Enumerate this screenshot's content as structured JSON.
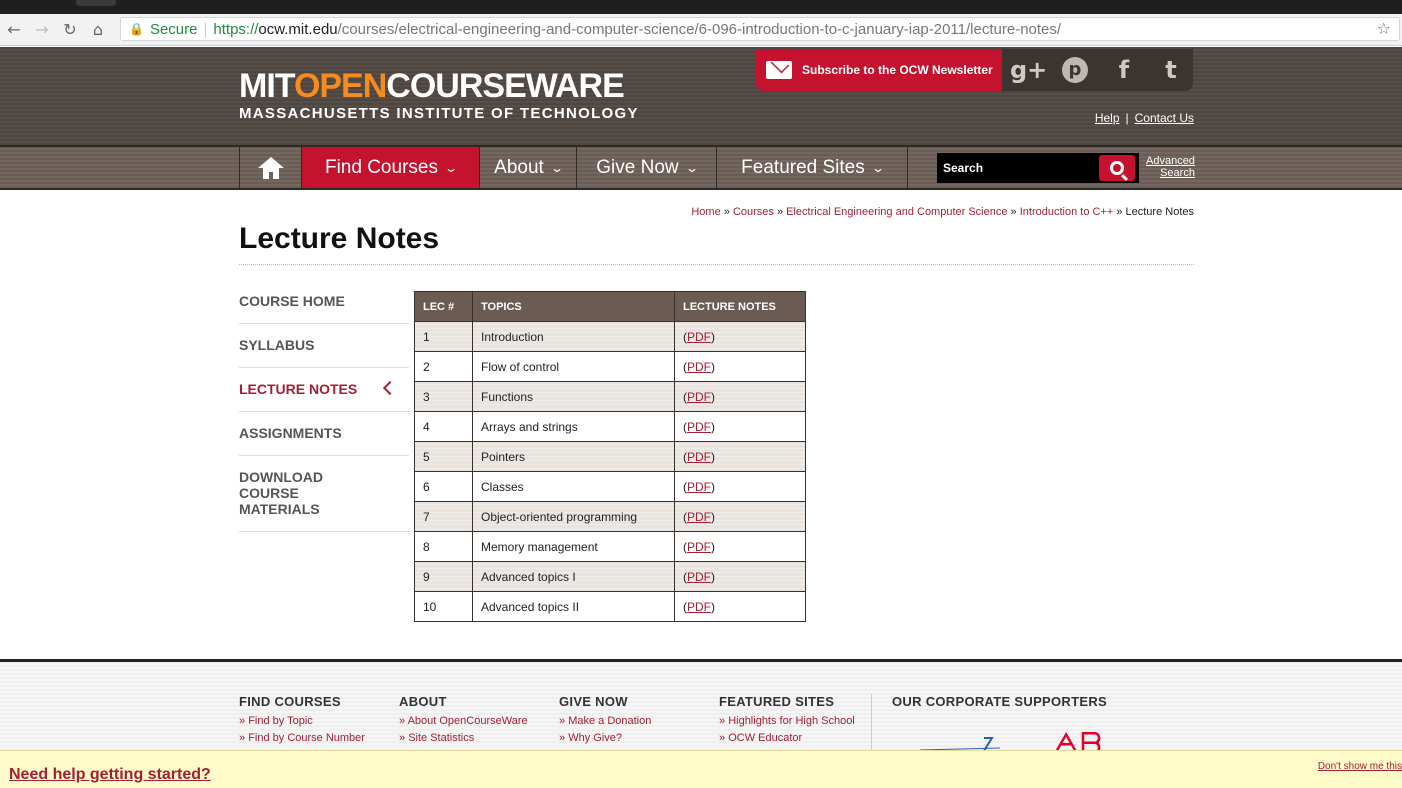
{
  "browser": {
    "secure_label": "Secure",
    "url_scheme": "https://",
    "url_host": "ocw.mit.edu",
    "url_path": "/courses/electrical-engineering-and-computer-science/6-096-introduction-to-c-january-iap-2011/lecture-notes/"
  },
  "header": {
    "logo_part1": "MIT",
    "logo_part2": "OPEN",
    "logo_part3": "COURSEWARE",
    "logo_sub": "MASSACHUSETTS INSTITUTE OF TECHNOLOGY",
    "subscribe_label": "Subscribe to the OCW Newsletter",
    "help_label": "Help",
    "contact_label": "Contact Us"
  },
  "nav": {
    "find_courses": "Find Courses",
    "about": "About",
    "give_now": "Give Now",
    "featured_sites": "Featured Sites",
    "search_placeholder": "Search",
    "advanced": "Advanced",
    "search": "Search"
  },
  "breadcrumb": {
    "items": [
      "Home",
      "Courses",
      "Electrical Engineering and Computer Science",
      "Introduction to C++"
    ],
    "current": "Lecture Notes"
  },
  "page_title": "Lecture Notes",
  "sidenav": {
    "items": [
      "COURSE HOME",
      "SYLLABUS",
      "LECTURE NOTES",
      "ASSIGNMENTS",
      "DOWNLOAD COURSE MATERIALS"
    ],
    "active": "LECTURE NOTES"
  },
  "table": {
    "headers": [
      "LEC #",
      "TOPICS",
      "LECTURE NOTES"
    ],
    "rows": [
      {
        "lec": "1",
        "topic": "Introduction",
        "notes": "PDF"
      },
      {
        "lec": "2",
        "topic": "Flow of control",
        "notes": "PDF"
      },
      {
        "lec": "3",
        "topic": "Functions",
        "notes": "PDF"
      },
      {
        "lec": "4",
        "topic": "Arrays and strings",
        "notes": "PDF"
      },
      {
        "lec": "5",
        "topic": "Pointers",
        "notes": "PDF"
      },
      {
        "lec": "6",
        "topic": "Classes",
        "notes": "PDF"
      },
      {
        "lec": "7",
        "topic": "Object-oriented programming",
        "notes": "PDF"
      },
      {
        "lec": "8",
        "topic": "Memory management",
        "notes": "PDF"
      },
      {
        "lec": "9",
        "topic": "Advanced topics I",
        "notes": "PDF"
      },
      {
        "lec": "10",
        "topic": "Advanced topics II",
        "notes": "PDF"
      }
    ]
  },
  "footer": {
    "find_courses": {
      "title": "FIND COURSES",
      "links": [
        "Find by Topic",
        "Find by Course Number"
      ]
    },
    "about": {
      "title": "ABOUT",
      "links": [
        "About OpenCourseWare",
        "Site Statistics"
      ]
    },
    "give_now": {
      "title": "GIVE NOW",
      "links": [
        "Make a Donation",
        "Why Give?"
      ]
    },
    "featured_sites": {
      "title": "FEATURED SITES",
      "links": [
        "Highlights for High School",
        "OCW Educator"
      ]
    },
    "supporters_title": "OUR CORPORATE SUPPORTERS"
  },
  "help_bar": {
    "link": "Need help getting started?",
    "dismiss": "Don't show me this"
  },
  "colors": {
    "mit_red": "#a31f34",
    "ocw_red": "#c4122f",
    "open_orange": "#f68b1f",
    "header_brown": "#4d4540"
  },
  "icons": [
    "back-arrow-icon",
    "forward-arrow-icon",
    "reload-icon",
    "home-icon",
    "lock-icon",
    "star-icon",
    "mail-icon",
    "google-plus-icon",
    "pinterest-icon",
    "facebook-icon",
    "twitter-icon",
    "search-icon",
    "chevron-down-icon",
    "chevron-left-icon"
  ]
}
